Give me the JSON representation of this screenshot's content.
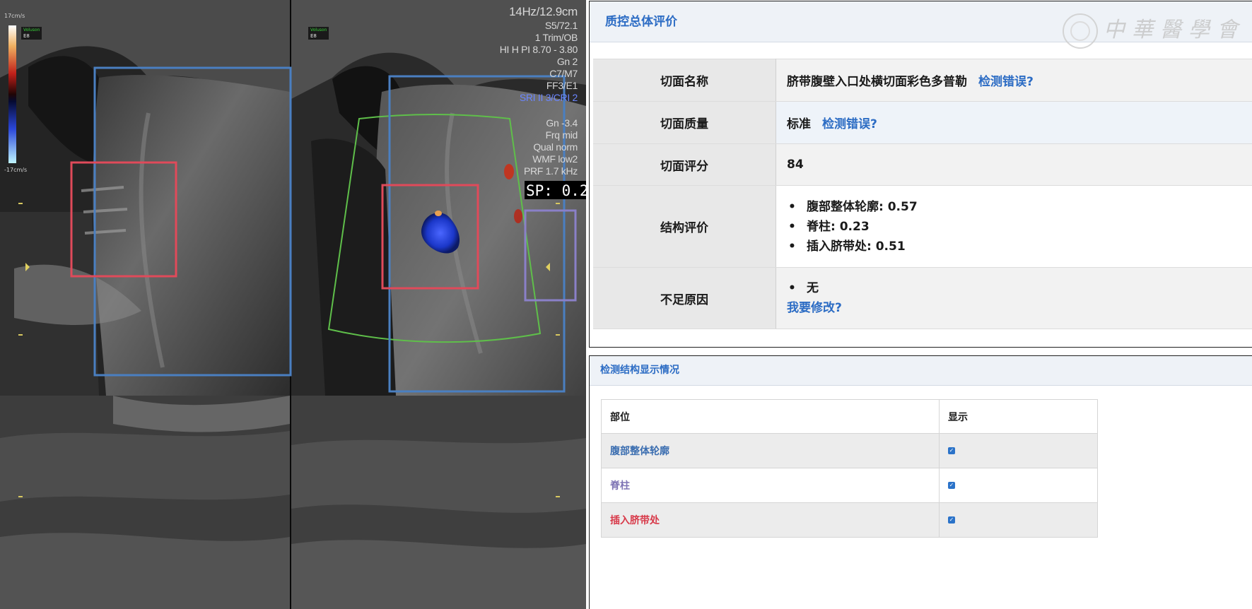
{
  "viewer": {
    "overlay_right": [
      "14Hz/12.9cm",
      "S5/72.1",
      "1 Trim/OB",
      "HI H PI 8.70 - 3.80",
      "Gn 2",
      "C7/M7",
      "FF3/E1",
      "SRI II 3/CRI 2",
      "Gn -3.4",
      "Frq mid",
      "Qual norm",
      "WMF low2",
      "PRF 1.7 kHz"
    ],
    "sp_label": "SP: 0.2",
    "scale_top": "17cm/s",
    "scale_bottom": "-17cm/s",
    "badge_left": {
      "mode": "Voluson",
      "label": "E8"
    },
    "badge_right": {
      "mode": "Voluson",
      "label": "E8"
    },
    "box_colors": {
      "blue": "#4a7fc1",
      "red": "#e04a5a",
      "green": "#5fbf4a",
      "purple": "#8a80c8"
    }
  },
  "qc_panel": {
    "title": "质控总体评价",
    "watermark": "中华医学会",
    "rows": [
      {
        "key": "切面名称",
        "value": "脐带腹壁入口处横切面彩色多普勒",
        "link": "检测错误?"
      },
      {
        "key": "切面质量",
        "value": "标准",
        "link": "检测错误?"
      },
      {
        "key": "切面评分",
        "value": "84"
      },
      {
        "key": "结构评价",
        "items": [
          "腹部整体轮廓: 0.57",
          "脊柱: 0.23",
          "插入脐带处: 0.51"
        ]
      },
      {
        "key": "不足原因",
        "items": [
          "无"
        ],
        "link": "我要修改?"
      }
    ]
  },
  "detection_panel": {
    "title": "检测结构显示情况",
    "headers": [
      "部位",
      "显示"
    ],
    "rows": [
      {
        "part": "腹部整体轮廓",
        "shown": true,
        "color": "#3a6db0"
      },
      {
        "part": "脊柱",
        "shown": true,
        "color": "#7f75b5"
      },
      {
        "part": "插入脐带处",
        "shown": true,
        "color": "#d83a4a"
      }
    ],
    "check_mark": "✓"
  }
}
